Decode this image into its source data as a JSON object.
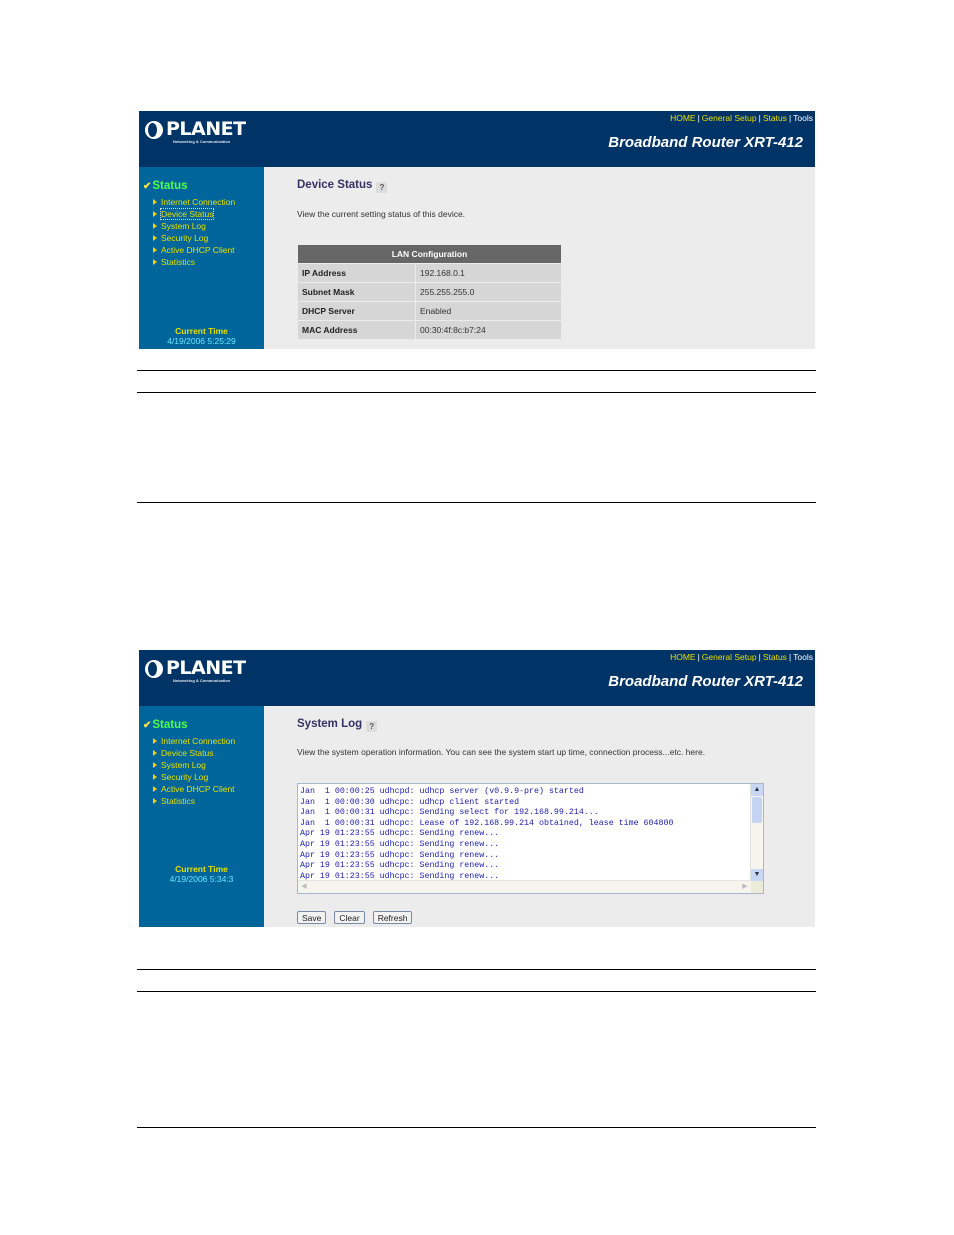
{
  "brand": {
    "logo_text": "PLANET",
    "logo_tagline": "Networking & Communication",
    "product": "Broadband Router XRT-412"
  },
  "top_links": [
    "HOME",
    "General Setup",
    "Status",
    "Tools"
  ],
  "sidebar": {
    "section": "Status",
    "items": [
      "Internet Connection",
      "Device Status",
      "System Log",
      "Security Log",
      "Active DHCP Client",
      "Statistics"
    ],
    "current_time_label": "Current Time"
  },
  "screens": [
    {
      "title": "Device Status",
      "description": "View the current setting status of this device.",
      "active_item": "Device Status",
      "current_time": "4/19/2006 5:25:29",
      "lan_table": {
        "header": "LAN Configuration",
        "rows": [
          {
            "label": "IP Address",
            "value": "192.168.0.1"
          },
          {
            "label": "Subnet Mask",
            "value": "255.255.255.0"
          },
          {
            "label": "DHCP Server",
            "value": "Enabled"
          },
          {
            "label": "MAC Address",
            "value": "00:30:4f:8c:b7:24"
          }
        ]
      }
    },
    {
      "title": "System Log",
      "description": "View the system operation information. You can see the system start up time, connection process...etc. here.",
      "current_time": "4/19/2006 5:34:3",
      "log_lines": [
        "Jan  1 00:00:25 udhcpd: udhcp server (v0.9.9-pre) started",
        "Jan  1 00:00:30 udhcpc: udhcp client started",
        "Jan  1 00:00:31 udhcpc: Sending select for 192.168.99.214...",
        "Jan  1 00:00:31 udhcpc: Lease of 192.168.99.214 obtained, lease time 604800",
        "Apr 19 01:23:55 udhcpc: Sending renew...",
        "Apr 19 01:23:55 udhcpc: Sending renew...",
        "Apr 19 01:23:55 udhcpc: Sending renew...",
        "Apr 19 01:23:55 udhcpc: Sending renew...",
        "Apr 19 01:23:55 udhcpc: Sending renew..."
      ],
      "buttons": {
        "save": "Save",
        "clear": "Clear",
        "refresh": "Refresh"
      }
    }
  ]
}
